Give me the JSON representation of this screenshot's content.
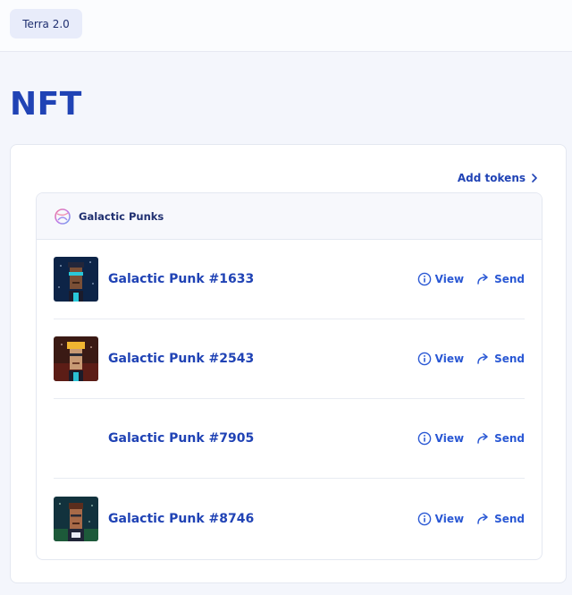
{
  "header": {
    "network_label": "Terra 2.0"
  },
  "page": {
    "title": "NFT"
  },
  "card": {
    "add_tokens_label": "Add tokens"
  },
  "collection": {
    "name": "Galactic Punks",
    "items": [
      {
        "name": "Galactic Punk #1633",
        "view_label": "View",
        "send_label": "Send",
        "has_image": true
      },
      {
        "name": "Galactic Punk #2543",
        "view_label": "View",
        "send_label": "Send",
        "has_image": true
      },
      {
        "name": "Galactic Punk #7905",
        "view_label": "View",
        "send_label": "Send",
        "has_image": false
      },
      {
        "name": "Galactic Punk #8746",
        "view_label": "View",
        "send_label": "Send",
        "has_image": true
      }
    ]
  },
  "colors": {
    "accent": "#2043b5",
    "link": "#2a58d4",
    "background": "#f4f6fc"
  },
  "icons": [
    "chevron-right-icon",
    "galactic-punks-logo-icon",
    "info-icon",
    "send-arrow-icon"
  ]
}
